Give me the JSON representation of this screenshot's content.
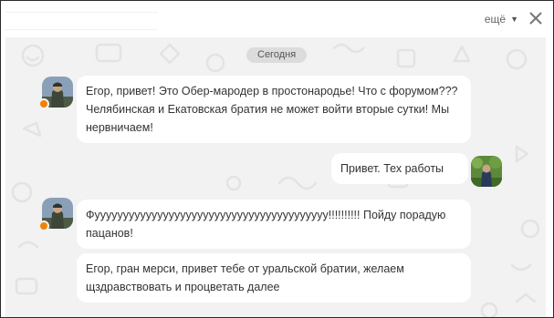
{
  "header": {
    "more_label": "ещё",
    "close_icon": "close-icon",
    "chevron_icon": "chevron-down-icon"
  },
  "date_separator": "Сегодня",
  "messages": [
    {
      "side": "left",
      "text": "Егор, привет! Это Обер-мародер в простонародье! Что с форумом??? Челябинская и Екатовская братия не может войти вторые сутки! Мы нервничаем!"
    },
    {
      "side": "right",
      "text": "Привет. Тех работы"
    },
    {
      "side": "left",
      "text": "Фууууууууууууууууууууууууууууууууууууууууу!!!!!!!!!! Пойду порадую пацанов!"
    },
    {
      "side": "left",
      "text": "Егор, гран мерси, привет тебе от уральской братии, желаем щздравствовать и процветать далее"
    }
  ],
  "colors": {
    "chat_background": "#f2f2f2",
    "bubble": "#ffffff",
    "date_pill": "#dcdcdc",
    "online_status": "#ee8208"
  }
}
